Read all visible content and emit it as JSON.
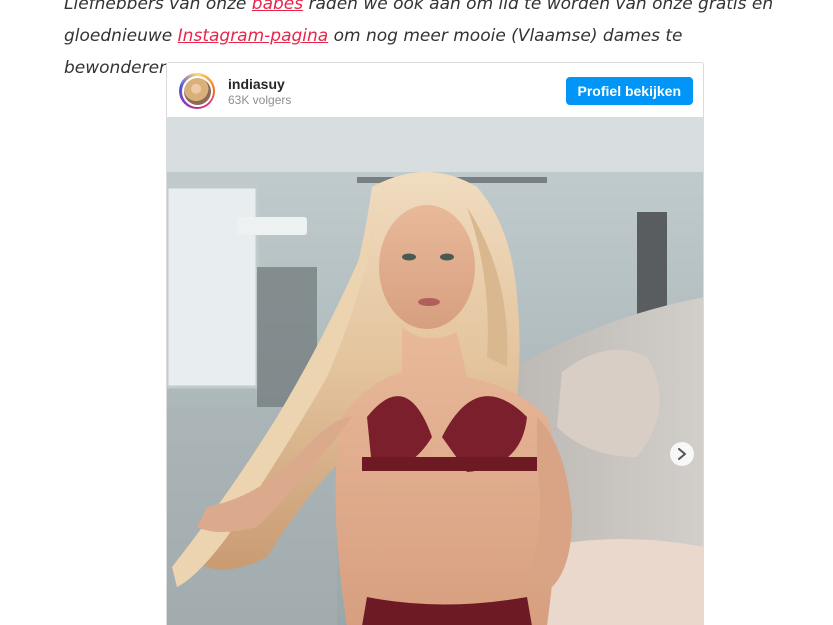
{
  "intro": {
    "line1_prefix": "Liefhebbers van onze ",
    "babes_link": "babes",
    "line1_suffix": " raden we ook aan om lid te worden van onze gratis en",
    "line2_prefix": "gloednieuwe ",
    "instagram_link": "Instagram-pagina",
    "line2_suffix": " om nog meer mooie (Vlaamse) dames te bewonderen."
  },
  "instagram_embed": {
    "username": "indiasuy",
    "followers": "63K volgers",
    "profile_button_label": "Profiel bekijken",
    "next_icon": "chevron-right-icon",
    "accent_color": "#0095f6",
    "link_color": "#e8254b"
  }
}
